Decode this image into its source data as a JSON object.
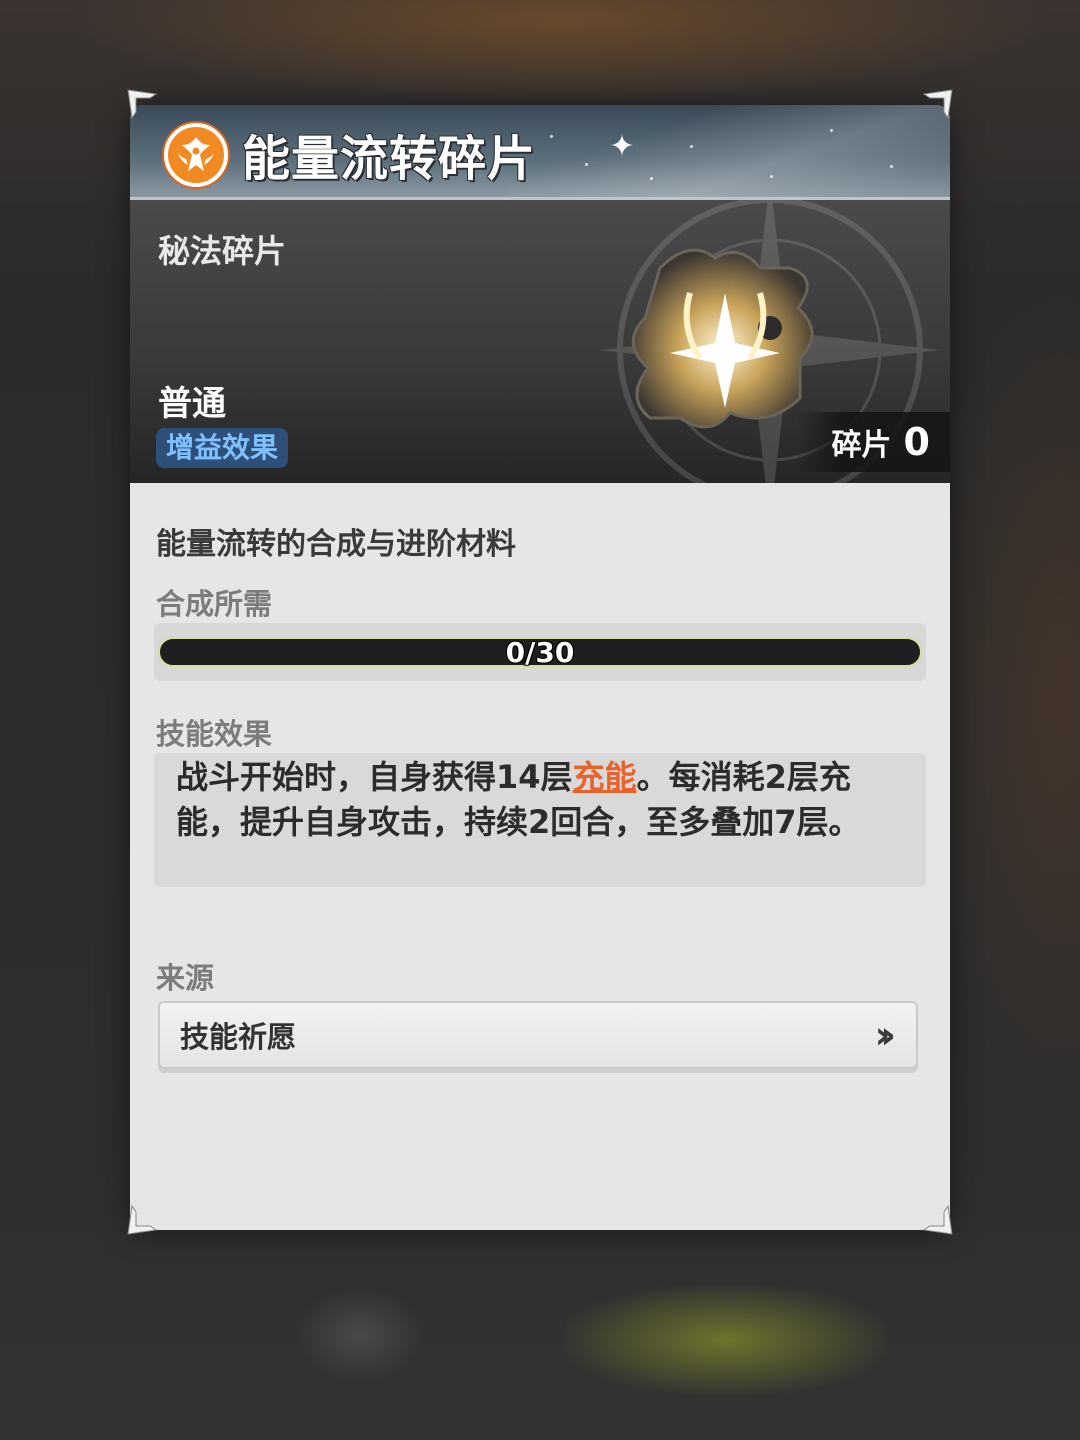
{
  "header": {
    "title": "能量流转碎片",
    "icon": "orange-spirit-emblem-icon",
    "accent_color": "#f28a23"
  },
  "item": {
    "type": "秘法碎片",
    "rarity": "普通",
    "tag": "增益效果",
    "count_label": "碎片",
    "count_value": "0",
    "image": "arcane-puzzle-piece-icon"
  },
  "details": {
    "description": "能量流转的合成与进阶材料",
    "synthesis_label": "合成所需",
    "progress_text": "0/30",
    "progress_fraction": 0,
    "skill_label": "技能效果",
    "skill_text": {
      "part1": "战斗开始时，自身获得14层",
      "keyword": "充能",
      "part2": "。每消耗2层充能，提升自身攻击，持续2回合，至多叠加7层。"
    },
    "keyword_color": "#e8622c",
    "source_label": "来源",
    "source_button": "技能祈愿",
    "source_icon": "double-chevron-right-icon"
  }
}
